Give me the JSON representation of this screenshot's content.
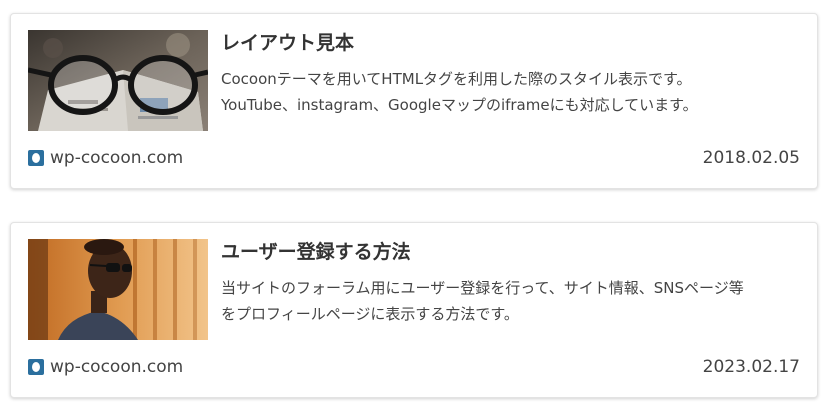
{
  "cards": [
    {
      "title": "レイアウト見本",
      "snippet_line1": "Cocoonテーマを用いてHTMLタグを利用した際のスタイル表示です。",
      "snippet_line2": "YouTube、instagram、Googleマップのiframeにも対応しています。",
      "site": "wp-cocoon.com",
      "date": "2018.02.05",
      "thumbnail_icon": "eyeglasses-on-magazine-photo"
    },
    {
      "title": "ユーザー登録する方法",
      "snippet_line1": "当サイトのフォーラム用にユーザー登録を行って、サイト情報、SNSページ等",
      "snippet_line2": "をプロフィールページに表示する方法です。",
      "site": "wp-cocoon.com",
      "date": "2023.02.17",
      "thumbnail_icon": "man-with-sunglasses-photo"
    }
  ],
  "colors": {
    "favicon": "#2b6f9e",
    "border": "#e3e3e3",
    "text": "#333333"
  }
}
